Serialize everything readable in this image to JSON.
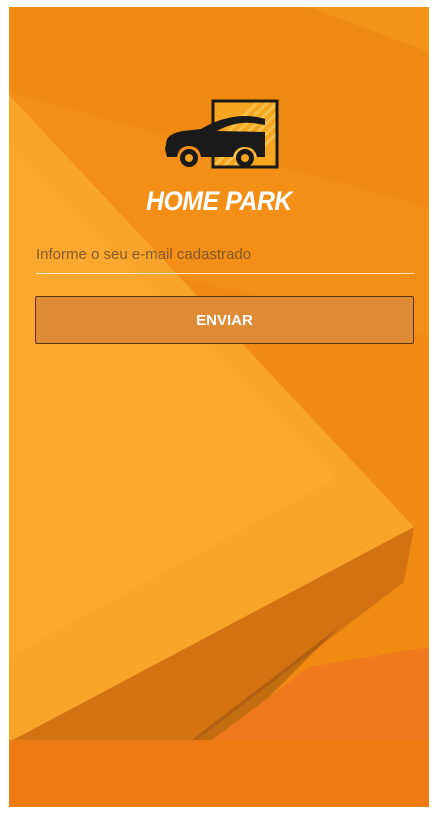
{
  "brand": {
    "name": "HOME PARK",
    "logo_icon": "car-icon"
  },
  "form": {
    "email_placeholder": "Informe o seu e-mail cadastrado",
    "email_value": "",
    "submit_label": "ENVIAR"
  },
  "colors": {
    "background_base": "#f18a12",
    "background_light": "#f9a52b",
    "button_fill": "#de8b35",
    "button_border": "#5b3513",
    "text": "#ffffff"
  }
}
